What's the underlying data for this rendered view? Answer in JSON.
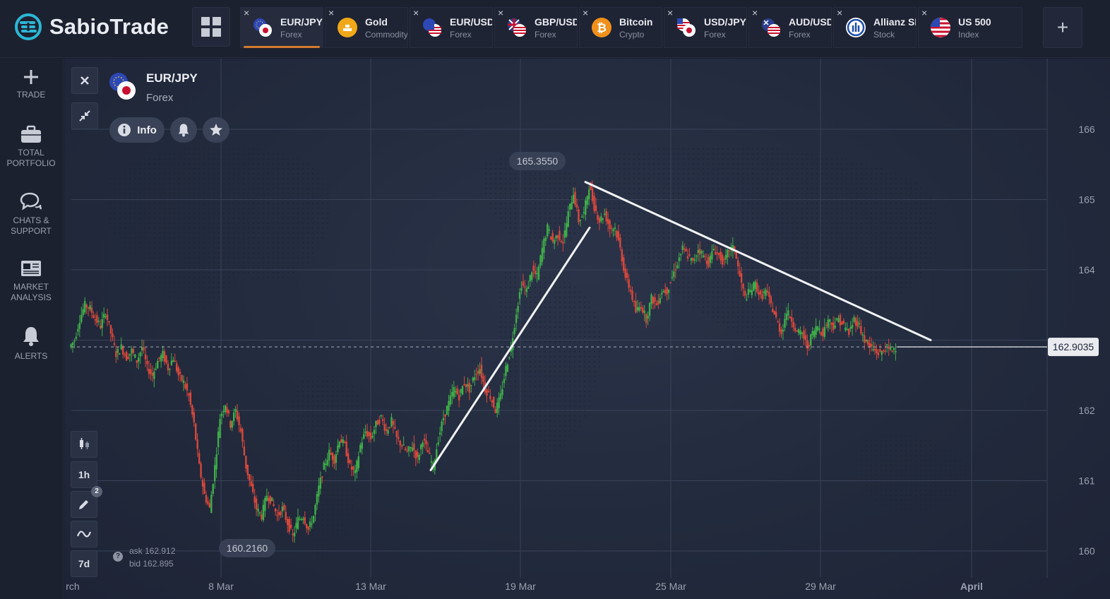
{
  "app": {
    "name": "SabioTrade"
  },
  "tabs": [
    {
      "name": "EUR/JPY",
      "type": "Forex",
      "icon": "eu-jp-flag-icon",
      "active": true
    },
    {
      "name": "Gold",
      "type": "Commodity",
      "icon": "gold-icon"
    },
    {
      "name": "EUR/USD",
      "type": "Forex",
      "icon": "eu-us-flag-icon"
    },
    {
      "name": "GBP/USD",
      "type": "Forex",
      "icon": "gb-us-flag-icon"
    },
    {
      "name": "Bitcoin",
      "type": "Crypto",
      "icon": "bitcoin-icon"
    },
    {
      "name": "USD/JPY",
      "type": "Forex",
      "icon": "us-jp-flag-icon"
    },
    {
      "name": "AUD/USD",
      "type": "Forex",
      "icon": "au-us-flag-icon"
    },
    {
      "name": "Allianz SE",
      "type": "Stock",
      "icon": "allianz-icon"
    },
    {
      "name": "US 500",
      "type": "Index",
      "icon": "us-flag-icon"
    }
  ],
  "sidebar": [
    {
      "label": "TRADE",
      "icon": "plus-icon"
    },
    {
      "label": "TOTAL PORTFOLIO",
      "icon": "briefcase-icon"
    },
    {
      "label": "CHATS & SUPPORT",
      "icon": "chat-icon"
    },
    {
      "label": "MARKET ANALYSIS",
      "icon": "newspaper-icon"
    },
    {
      "label": "ALERTS",
      "icon": "bell-icon"
    }
  ],
  "asset": {
    "name": "EUR/JPY",
    "type": "Forex",
    "info_label": "Info"
  },
  "toolbar": {
    "timeframe": "1h",
    "period": "7d",
    "drawings_badge": "2"
  },
  "quote": {
    "ask": "ask 162.912",
    "bid": "bid 162.895"
  },
  "colors": {
    "up": "#3fae49",
    "down": "#d9483b",
    "accent": "#d37a2d",
    "background": "#222a3d"
  },
  "chart_data": {
    "type": "candlestick",
    "y_ticks": [
      160,
      161,
      162,
      163,
      164,
      165,
      166
    ],
    "y_tick_labels": [
      "160",
      "161",
      "162",
      "164",
      "165",
      "166"
    ],
    "x_tick_labels": [
      "rch",
      "8 Mar",
      "13 Mar",
      "19 Mar",
      "25 Mar",
      "29 Mar",
      "April"
    ],
    "current_price": "162.9035",
    "high_label": "165.3550",
    "low_label": "160.2160",
    "close_series": [
      163.0,
      163.3,
      163.5,
      163.45,
      163.3,
      163.2,
      163.4,
      163.1,
      162.8,
      162.9,
      162.75,
      162.85,
      162.7,
      162.9,
      162.6,
      162.5,
      162.7,
      162.8,
      162.6,
      162.75,
      162.5,
      162.4,
      162.2,
      161.8,
      161.2,
      160.8,
      160.6,
      161.2,
      161.9,
      162.1,
      161.8,
      162.0,
      161.7,
      161.2,
      160.9,
      160.6,
      160.5,
      160.8,
      160.7,
      160.5,
      160.6,
      160.4,
      160.2,
      160.45,
      160.5,
      160.3,
      160.5,
      160.9,
      161.2,
      161.4,
      161.3,
      161.6,
      161.5,
      161.2,
      161.1,
      161.5,
      161.7,
      161.6,
      161.8,
      161.9,
      161.7,
      161.85,
      161.6,
      161.5,
      161.4,
      161.5,
      161.3,
      161.6,
      161.4,
      161.2,
      161.6,
      161.9,
      162.1,
      162.3,
      162.2,
      162.4,
      162.3,
      162.5,
      162.6,
      162.3,
      162.2,
      162.0,
      162.2,
      162.6,
      162.9,
      163.4,
      163.8,
      163.7,
      164.0,
      163.9,
      164.3,
      164.6,
      164.4,
      164.5,
      164.4,
      164.8,
      165.1,
      164.7,
      164.8,
      165.2,
      164.9,
      164.7,
      164.8,
      164.6,
      164.6,
      164.3,
      163.9,
      163.7,
      163.4,
      163.5,
      163.3,
      163.6,
      163.5,
      163.7,
      163.7,
      163.9,
      164.1,
      164.3,
      164.2,
      164.1,
      164.3,
      164.2,
      164.1,
      164.3,
      164.2,
      164.1,
      164.3,
      164.3,
      163.9,
      163.6,
      163.7,
      163.8,
      163.6,
      163.7,
      163.5,
      163.3,
      163.1,
      163.4,
      163.3,
      163.1,
      163.1,
      162.9,
      163.1,
      163.2,
      163.1,
      163.3,
      163.2,
      163.3,
      163.2,
      163.1,
      163.3,
      163.2,
      163.0,
      162.9,
      162.85,
      162.8,
      162.9,
      162.85,
      162.9
    ],
    "trendlines": [
      {
        "from": [
          "14 Mar",
          161.15
        ],
        "to": [
          "21 Mar",
          164.6
        ]
      },
      {
        "from": [
          "20 Mar",
          165.25
        ],
        "to": [
          "31 Mar",
          163.0
        ]
      }
    ]
  }
}
